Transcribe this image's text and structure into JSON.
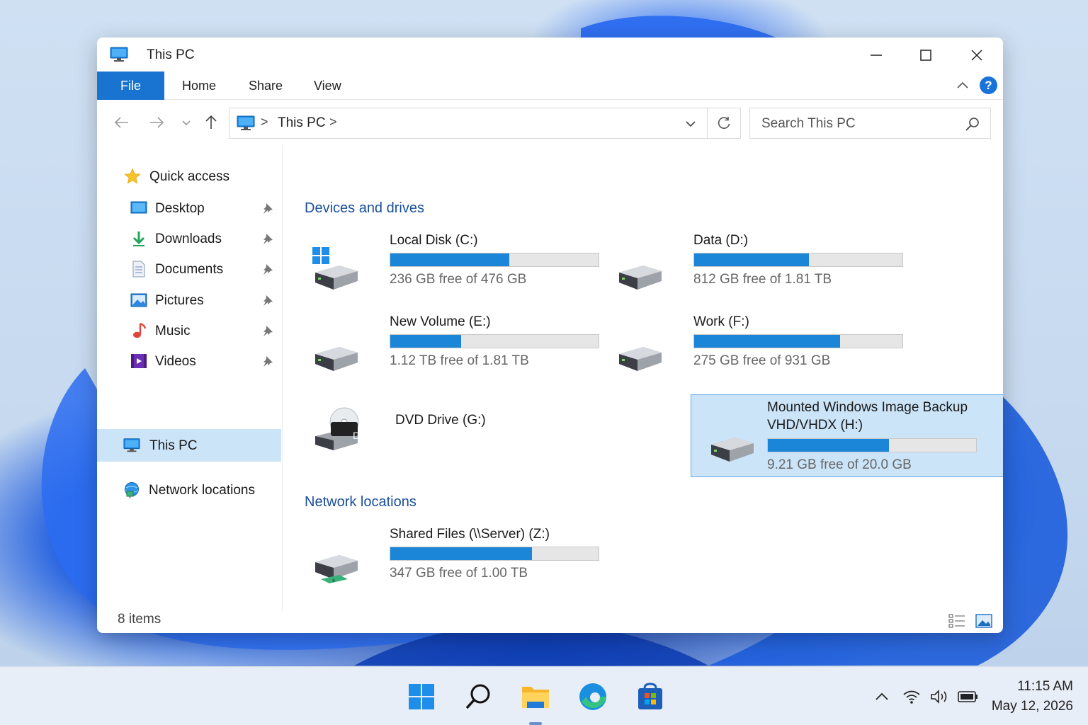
{
  "window": {
    "title": "This PC",
    "icon": "monitor-icon"
  },
  "ribbon": {
    "tabs": [
      "File",
      "Home",
      "Share",
      "View"
    ],
    "help_label": "?"
  },
  "address": {
    "location": "This PC",
    "separator": ">"
  },
  "search": {
    "placeholder": "Search This PC"
  },
  "sidebar": {
    "quick_access": "Quick access",
    "items": [
      {
        "label": "Desktop",
        "icon": "desktop-icon"
      },
      {
        "label": "Downloads",
        "icon": "download-icon"
      },
      {
        "label": "Documents",
        "icon": "documents-icon"
      },
      {
        "label": "Pictures",
        "icon": "pictures-icon"
      },
      {
        "label": "Music",
        "icon": "music-icon"
      },
      {
        "label": "Videos",
        "icon": "videos-icon"
      }
    ],
    "this_pc": "This PC",
    "network": "Network locations"
  },
  "content": {
    "devices_title": "Devices and drives",
    "network_title": "Network locations",
    "drives": [
      {
        "name": "Local Disk (C:)",
        "free": "236 GB free of 476 GB",
        "used_fraction": 0.57,
        "icon": "windows-drive-icon"
      },
      {
        "name": "Data (D:)",
        "free": "812 GB free of 1.81 TB",
        "used_fraction": 0.55,
        "icon": "hard-drive-icon"
      },
      {
        "name": "New Volume (E:)",
        "free": "1.12 TB free of 1.81 TB",
        "used_fraction": 0.34,
        "icon": "hard-drive-icon"
      },
      {
        "name": "Work (F:)",
        "free": "275 GB free of 931 GB",
        "used_fraction": 0.7,
        "icon": "hard-drive-icon"
      },
      {
        "name": "DVD Drive (G:)",
        "icon": "dvd-drive-icon",
        "badge": "DVD"
      },
      {
        "name": "Mounted Windows Image Backup VHD/VHDX (H:)",
        "free": "9.21 GB free of 20.0 GB",
        "used_fraction": 0.58,
        "icon": "hard-drive-icon",
        "selected": true
      }
    ],
    "network_drives": [
      {
        "name": "Shared Files (\\\\Server) (Z:)",
        "free": "347 GB free of 1.00 TB",
        "used_fraction": 0.68,
        "icon": "network-drive-icon"
      }
    ]
  },
  "status": {
    "items_count": "8 items"
  },
  "taskbar": {
    "apps": [
      "start-icon",
      "search-icon",
      "file-explorer-icon",
      "edge-icon",
      "store-icon"
    ],
    "time": "11:15 AM",
    "date": "May 12, 2026"
  },
  "colors": {
    "accent": "#1874d0",
    "progress": "#1b86d8",
    "selection": "#cce4f7",
    "heading": "#1a4f9c"
  }
}
